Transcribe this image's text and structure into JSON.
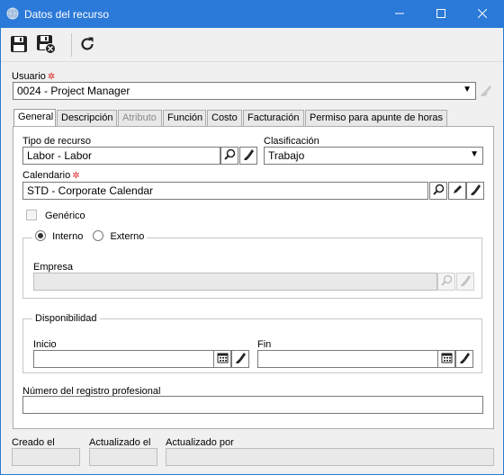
{
  "window": {
    "title": "Datos del recurso",
    "minimize_icon": "minimize-icon",
    "maximize_icon": "maximize-icon",
    "close_icon": "close-icon"
  },
  "toolbar": {
    "buttons": [
      "save-icon",
      "save-and-close-icon",
      "refresh-icon"
    ]
  },
  "usuario": {
    "label": "Usuario",
    "required_mark": "✲",
    "value": "0024 - Project Manager"
  },
  "tabs": [
    {
      "label": "General",
      "state": "active"
    },
    {
      "label": "Descripción",
      "state": "normal"
    },
    {
      "label": "Atributo",
      "state": "disabled"
    },
    {
      "label": "Función",
      "state": "normal"
    },
    {
      "label": "Costo",
      "state": "normal"
    },
    {
      "label": "Facturación",
      "state": "normal"
    },
    {
      "label": "Permiso para apunte de horas",
      "state": "normal"
    }
  ],
  "general": {
    "tipo_recurso": {
      "label": "Tipo de recurso",
      "value": "Labor - Labor"
    },
    "clasificacion": {
      "label": "Clasificación",
      "value": "Trabajo"
    },
    "calendario": {
      "label": "Calendario",
      "required_mark": "✲",
      "value": "STD - Corporate Calendar"
    },
    "generico": {
      "label": "Genérico",
      "checked": false
    },
    "interno": {
      "label": "Interno",
      "checked": true
    },
    "externo": {
      "label": "Externo",
      "checked": false
    },
    "empresa": {
      "label": "Empresa",
      "value": ""
    },
    "disponibilidad": {
      "legend": "Disponibilidad",
      "inicio": {
        "label": "Inicio",
        "value": ""
      },
      "fin": {
        "label": "Fin",
        "value": ""
      }
    },
    "registro": {
      "label": "Número del registro profesional",
      "value": ""
    }
  },
  "footer": {
    "creado": {
      "label": "Creado el",
      "value": ""
    },
    "actualizado_el": {
      "label": "Actualizado el",
      "value": ""
    },
    "actualizado_por": {
      "label": "Actualizado por",
      "value": ""
    }
  },
  "colors": {
    "titlebar": "#2b79d8",
    "required": "#dd2222"
  }
}
